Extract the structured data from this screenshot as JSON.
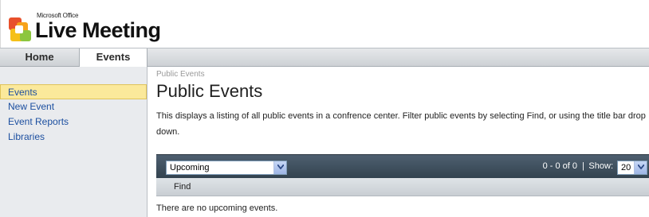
{
  "header": {
    "logo_small": "Microsoft Office",
    "logo_big": "Live Meeting"
  },
  "tabs": [
    {
      "label": "Home"
    },
    {
      "label": "Events"
    }
  ],
  "sidebar": {
    "items": [
      {
        "label": "Events",
        "active": true
      },
      {
        "label": "New Event"
      },
      {
        "label": "Event Reports"
      },
      {
        "label": "Libraries"
      }
    ]
  },
  "main": {
    "breadcrumb": "Public Events",
    "title": "Public Events",
    "description": "This displays a listing of all public events in a confrence center. Filter public events by selecting Find, or using the title bar drop down.",
    "filter": {
      "selected": "Upcoming",
      "count": "0 - 0 of 0",
      "separator": "|",
      "show_label": "Show:",
      "show_value": "20"
    },
    "find_label": "Find",
    "empty_message": "There are no upcoming events."
  },
  "colors": {
    "active_item_bg": "#fbe99b",
    "link": "#1c4fa0",
    "filterbar": "#3f4f5e"
  }
}
